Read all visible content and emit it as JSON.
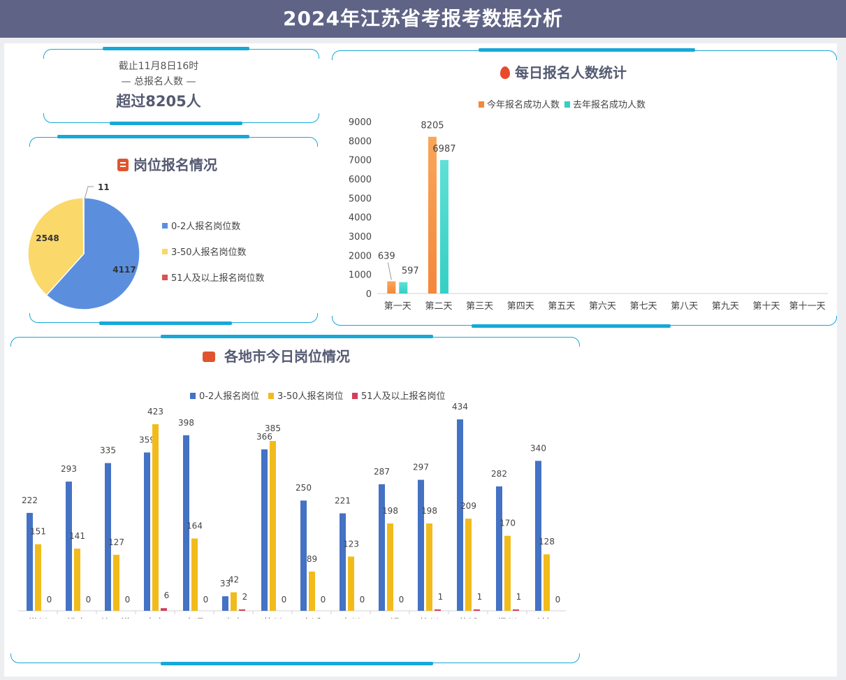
{
  "header": {
    "title": "2024年江苏省考报考数据分析"
  },
  "summary": {
    "line1": "截止11月8日16时",
    "line2": "— 总报名人数 —",
    "line3": "超过8205人"
  },
  "colors": {
    "header_bg": "#5f6386",
    "frame": "#16a8d8",
    "pie_blue": "#5b8fde",
    "pie_yellow": "#fbd86a",
    "pie_red": "#d9534f",
    "orange": "#f4873a",
    "teal": "#35cfc4",
    "city_blue": "#4472c4",
    "city_yellow": "#f2bb1c",
    "city_red": "#d1405a"
  },
  "chart_data": [
    {
      "id": "pie",
      "type": "pie",
      "title": "岗位报名情况",
      "title_icon": "clipboard-icon",
      "categories": [
        "0-2人报名岗位数",
        "3-50人报名岗位数",
        "51人及以上报名岗位数"
      ],
      "values": [
        4117,
        2548,
        11
      ],
      "legend": "right"
    },
    {
      "id": "daily",
      "type": "bar",
      "title": "每日报名人数统计",
      "title_icon": "fire-icon",
      "categories": [
        "第一天",
        "第二天",
        "第三天",
        "第四天",
        "第五天",
        "第六天",
        "第七天",
        "第八天",
        "第九天",
        "第十天",
        "第十一天"
      ],
      "series": [
        {
          "name": "今年报名成功人数",
          "values": [
            639,
            8205,
            null,
            null,
            null,
            null,
            null,
            null,
            null,
            null,
            null
          ]
        },
        {
          "name": "去年报名成功人数",
          "values": [
            597,
            6987,
            null,
            null,
            null,
            null,
            null,
            null,
            null,
            null,
            null
          ]
        }
      ],
      "ylim": [
        0,
        9000
      ],
      "yticks": [
        0,
        1000,
        2000,
        3000,
        4000,
        5000,
        6000,
        7000,
        8000,
        9000
      ],
      "legend": "top"
    },
    {
      "id": "cities",
      "type": "bar",
      "title": "各地市今日岗位情况",
      "title_icon": "chat-icon",
      "categories": [
        "常州",
        "淮安",
        "连云港",
        "南京",
        "南通",
        "省直",
        "苏州",
        "宿迁",
        "泰州",
        "无锡",
        "徐州",
        "盐城",
        "扬州",
        "镇江"
      ],
      "series": [
        {
          "name": "0-2人报名岗位",
          "values": [
            222,
            293,
            335,
            359,
            398,
            33,
            366,
            250,
            221,
            287,
            297,
            434,
            282,
            340
          ]
        },
        {
          "name": "3-50人报名岗位",
          "values": [
            151,
            141,
            127,
            423,
            164,
            42,
            385,
            89,
            123,
            198,
            198,
            209,
            170,
            128
          ]
        },
        {
          "name": "51人及以上报名岗位",
          "values": [
            0,
            0,
            0,
            6,
            0,
            2,
            0,
            0,
            0,
            0,
            1,
            1,
            1,
            0
          ]
        }
      ],
      "ylim": [
        0,
        450
      ],
      "legend": "top"
    }
  ]
}
